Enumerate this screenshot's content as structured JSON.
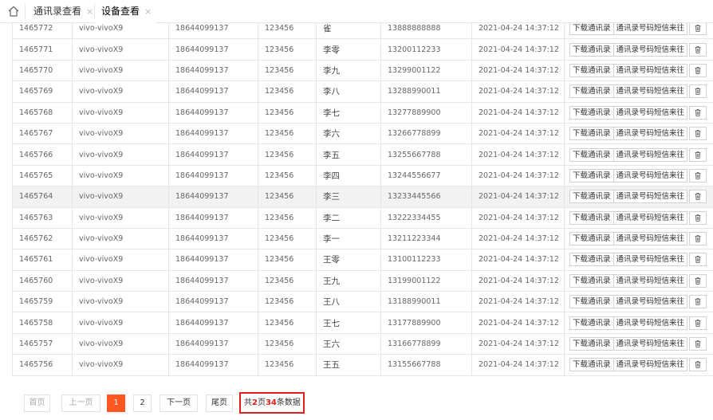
{
  "tabs": [
    {
      "label": "通讯录查看",
      "close": "×"
    },
    {
      "label": "设备查看",
      "close": "×"
    }
  ],
  "actions": {
    "download": "下载通讯录",
    "sms": "通讯录号码短信来往"
  },
  "rows": [
    {
      "id": "1465772",
      "device": "vivo-vivoX9",
      "phone": "18644099137",
      "code": "123456",
      "name": "雀",
      "contact": "13888888888",
      "time": "2021-04-24 14:37:12"
    },
    {
      "id": "1465771",
      "device": "vivo-vivoX9",
      "phone": "18644099137",
      "code": "123456",
      "name": "李零",
      "contact": "13200112233",
      "time": "2021-04-24 14:37:12"
    },
    {
      "id": "1465770",
      "device": "vivo-vivoX9",
      "phone": "18644099137",
      "code": "123456",
      "name": "李九",
      "contact": "13299001122",
      "time": "2021-04-24 14:37:12"
    },
    {
      "id": "1465769",
      "device": "vivo-vivoX9",
      "phone": "18644099137",
      "code": "123456",
      "name": "李八",
      "contact": "13288990011",
      "time": "2021-04-24 14:37:12"
    },
    {
      "id": "1465768",
      "device": "vivo-vivoX9",
      "phone": "18644099137",
      "code": "123456",
      "name": "李七",
      "contact": "13277889900",
      "time": "2021-04-24 14:37:12"
    },
    {
      "id": "1465767",
      "device": "vivo-vivoX9",
      "phone": "18644099137",
      "code": "123456",
      "name": "李六",
      "contact": "13266778899",
      "time": "2021-04-24 14:37:12"
    },
    {
      "id": "1465766",
      "device": "vivo-vivoX9",
      "phone": "18644099137",
      "code": "123456",
      "name": "李五",
      "contact": "13255667788",
      "time": "2021-04-24 14:37:12"
    },
    {
      "id": "1465765",
      "device": "vivo-vivoX9",
      "phone": "18644099137",
      "code": "123456",
      "name": "李四",
      "contact": "13244556677",
      "time": "2021-04-24 14:37:12"
    },
    {
      "id": "1465764",
      "device": "vivo-vivoX9",
      "phone": "18644099137",
      "code": "123456",
      "name": "李三",
      "contact": "13233445566",
      "time": "2021-04-24 14:37:12"
    },
    {
      "id": "1465763",
      "device": "vivo-vivoX9",
      "phone": "18644099137",
      "code": "123456",
      "name": "李二",
      "contact": "13222334455",
      "time": "2021-04-24 14:37:12"
    },
    {
      "id": "1465762",
      "device": "vivo-vivoX9",
      "phone": "18644099137",
      "code": "123456",
      "name": "李一",
      "contact": "13211223344",
      "time": "2021-04-24 14:37:12"
    },
    {
      "id": "1465761",
      "device": "vivo-vivoX9",
      "phone": "18644099137",
      "code": "123456",
      "name": "王零",
      "contact": "13100112233",
      "time": "2021-04-24 14:37:12"
    },
    {
      "id": "1465760",
      "device": "vivo-vivoX9",
      "phone": "18644099137",
      "code": "123456",
      "name": "王九",
      "contact": "13199001122",
      "time": "2021-04-24 14:37:12"
    },
    {
      "id": "1465759",
      "device": "vivo-vivoX9",
      "phone": "18644099137",
      "code": "123456",
      "name": "王八",
      "contact": "13188990011",
      "time": "2021-04-24 14:37:12"
    },
    {
      "id": "1465758",
      "device": "vivo-vivoX9",
      "phone": "18644099137",
      "code": "123456",
      "name": "王七",
      "contact": "13177889900",
      "time": "2021-04-24 14:37:12"
    },
    {
      "id": "1465757",
      "device": "vivo-vivoX9",
      "phone": "18644099137",
      "code": "123456",
      "name": "王六",
      "contact": "13166778899",
      "time": "2021-04-24 14:37:12"
    },
    {
      "id": "1465756",
      "device": "vivo-vivoX9",
      "phone": "18644099137",
      "code": "123456",
      "name": "王五",
      "contact": "13155667788",
      "time": "2021-04-24 14:37:12"
    }
  ],
  "highlighted_row": 8,
  "pagination": {
    "first": "首页",
    "prev": "上一页",
    "pages": [
      "1",
      "2"
    ],
    "current_page": "1",
    "next": "下一页",
    "last": "尾页",
    "info_prefix": "共",
    "total_pages": "2",
    "info_mid": "页",
    "total_records": "34",
    "info_suffix": "条数据"
  },
  "colors": {
    "accent": "#ff5722",
    "highlight_border": "#e0201b",
    "hover_row": "#f2f2f2"
  },
  "icons": {
    "home": "home-icon",
    "delete": "trash-icon"
  }
}
